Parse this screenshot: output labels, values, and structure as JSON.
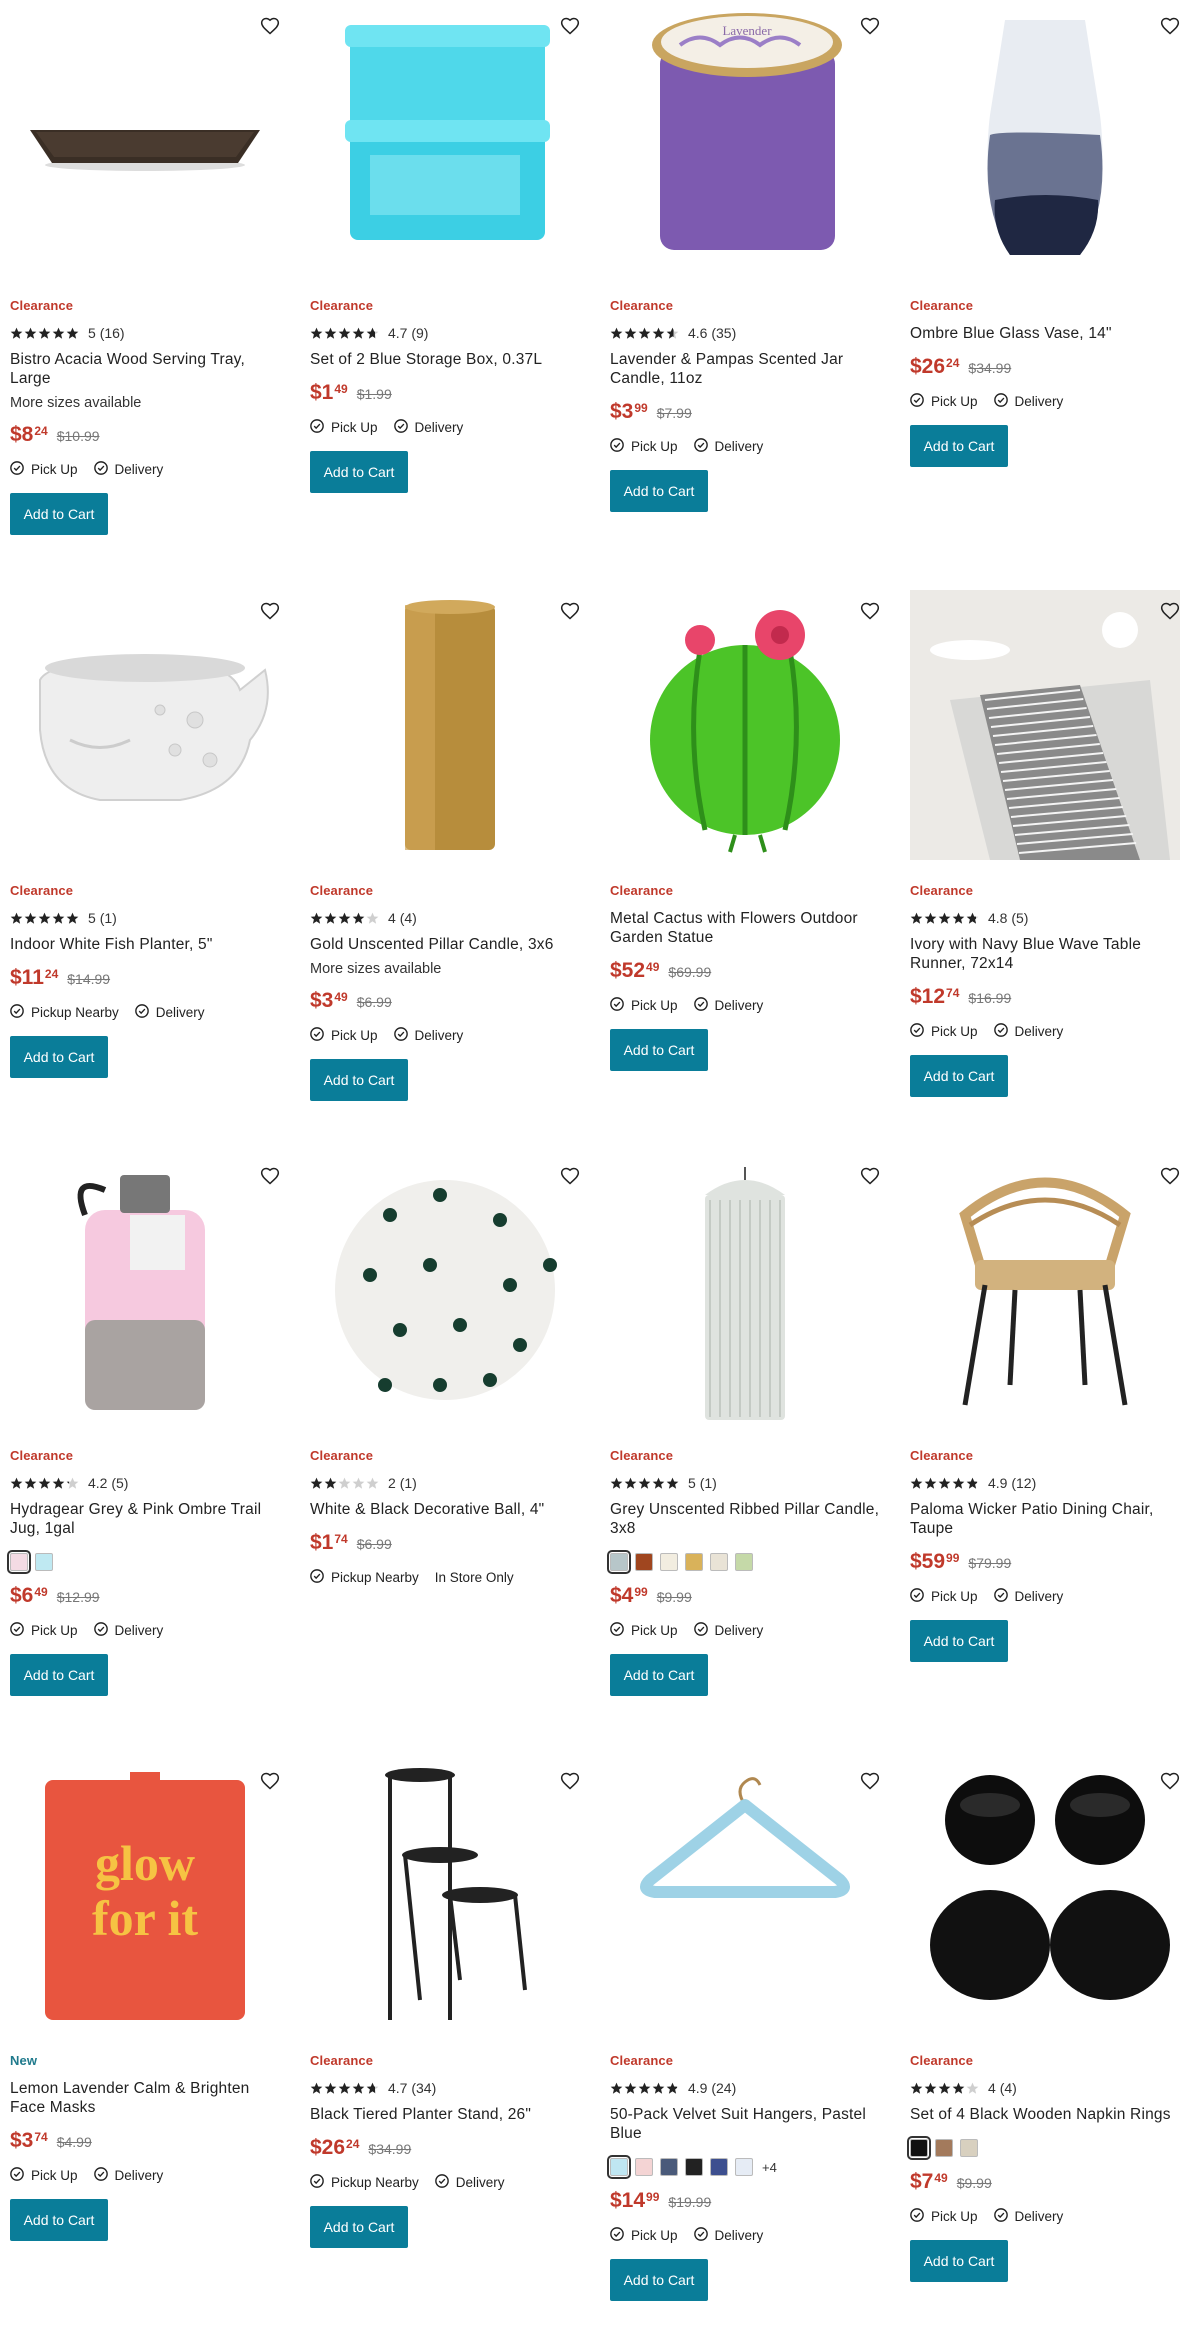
{
  "add_to_cart_label": "Add to Cart",
  "colors": {
    "clearance": "#c0392b",
    "new": "#1f7a8c",
    "button": "#0a7d99",
    "price": "#c0392b"
  },
  "products": [
    {
      "badge": "Clearance",
      "rating": "5",
      "reviews": "(16)",
      "stars": 5,
      "title": "Bistro Acacia Wood Serving Tray, Large",
      "sizes": "More sizes available",
      "price_dollars": "$8",
      "price_cents": "24",
      "was": "$10.99",
      "fulfillment": [
        "Pick Up",
        "Delivery"
      ],
      "image": "serving-tray"
    },
    {
      "badge": "Clearance",
      "rating": "4.7",
      "reviews": "(9)",
      "stars": 4.7,
      "title": "Set of 2 Blue Storage Box, 0.37L",
      "price_dollars": "$1",
      "price_cents": "49",
      "was": "$1.99",
      "fulfillment": [
        "Pick Up",
        "Delivery"
      ],
      "image": "storage-box"
    },
    {
      "badge": "Clearance",
      "rating": "4.6",
      "reviews": "(35)",
      "stars": 4.6,
      "title": "Lavender & Pampas Scented Jar Candle, 11oz",
      "price_dollars": "$3",
      "price_cents": "99",
      "was": "$7.99",
      "fulfillment": [
        "Pick Up",
        "Delivery"
      ],
      "image": "jar-candle"
    },
    {
      "badge": "Clearance",
      "title": "Ombre Blue Glass Vase, 14\"",
      "price_dollars": "$26",
      "price_cents": "24",
      "was": "$34.99",
      "fulfillment": [
        "Pick Up",
        "Delivery"
      ],
      "image": "vase"
    },
    {
      "badge": "Clearance",
      "rating": "5",
      "reviews": "(1)",
      "stars": 5,
      "title": "Indoor White Fish Planter, 5\"",
      "price_dollars": "$11",
      "price_cents": "24",
      "was": "$14.99",
      "fulfillment": [
        "Pickup Nearby",
        "Delivery"
      ],
      "image": "fish-planter"
    },
    {
      "badge": "Clearance",
      "rating": "4",
      "reviews": "(4)",
      "stars": 4,
      "title": "Gold Unscented Pillar Candle, 3x6",
      "sizes": "More sizes available",
      "price_dollars": "$3",
      "price_cents": "49",
      "was": "$6.99",
      "fulfillment": [
        "Pick Up",
        "Delivery"
      ],
      "image": "gold-candle"
    },
    {
      "badge": "Clearance",
      "title": "Metal Cactus with Flowers Outdoor Garden Statue",
      "price_dollars": "$52",
      "price_cents": "49",
      "was": "$69.99",
      "fulfillment": [
        "Pick Up",
        "Delivery"
      ],
      "image": "cactus"
    },
    {
      "badge": "Clearance",
      "rating": "4.8",
      "reviews": "(5)",
      "stars": 4.8,
      "title": "Ivory with Navy Blue Wave Table Runner, 72x14",
      "price_dollars": "$12",
      "price_cents": "74",
      "was": "$16.99",
      "fulfillment": [
        "Pick Up",
        "Delivery"
      ],
      "image": "table-runner"
    },
    {
      "badge": "Clearance",
      "rating": "4.2",
      "reviews": "(5)",
      "stars": 4.2,
      "title": "Hydragear Grey & Pink Ombre Trail Jug, 1gal",
      "swatches": [
        "#f4dbe4",
        "#bfe9f2"
      ],
      "price_dollars": "$6",
      "price_cents": "49",
      "was": "$12.99",
      "fulfillment": [
        "Pick Up",
        "Delivery"
      ],
      "image": "water-jug"
    },
    {
      "badge": "Clearance",
      "rating": "2",
      "reviews": "(1)",
      "stars": 2,
      "title": "White & Black Decorative Ball, 4\"",
      "price_dollars": "$1",
      "price_cents": "74",
      "was": "$6.99",
      "fulfillment": [
        "Pickup Nearby",
        "In Store Only"
      ],
      "fulfillment_check": [
        true,
        false
      ],
      "no_button": true,
      "image": "deco-ball"
    },
    {
      "badge": "Clearance",
      "rating": "5",
      "reviews": "(1)",
      "stars": 5,
      "title": "Grey Unscented Ribbed Pillar Candle, 3x8",
      "swatches": [
        "#b7c6c9",
        "#a0461f",
        "#f2ede0",
        "#d9b25a",
        "#e9e3d6",
        "#c5d9a8"
      ],
      "price_dollars": "$4",
      "price_cents": "99",
      "was": "$9.99",
      "fulfillment": [
        "Pick Up",
        "Delivery"
      ],
      "image": "ribbed-candle"
    },
    {
      "badge": "Clearance",
      "rating": "4.9",
      "reviews": "(12)",
      "stars": 4.9,
      "title": "Paloma Wicker Patio Dining Chair, Taupe",
      "price_dollars": "$59",
      "price_cents": "99",
      "was": "$79.99",
      "fulfillment": [
        "Pick Up",
        "Delivery"
      ],
      "image": "wicker-chair"
    },
    {
      "badge": "New",
      "title": "Lemon Lavender Calm & Brighten Face Masks",
      "price_dollars": "$3",
      "price_cents": "74",
      "was": "$4.99",
      "fulfillment": [
        "Pick Up",
        "Delivery"
      ],
      "image": "face-mask",
      "mask_text": "glow for it"
    },
    {
      "badge": "Clearance",
      "rating": "4.7",
      "reviews": "(34)",
      "stars": 4.7,
      "title": "Black Tiered Planter Stand, 26\"",
      "price_dollars": "$26",
      "price_cents": "24",
      "was": "$34.99",
      "fulfillment": [
        "Pickup Nearby",
        "Delivery"
      ],
      "image": "planter-stand"
    },
    {
      "badge": "Clearance",
      "rating": "4.9",
      "reviews": "(24)",
      "stars": 4.9,
      "title": "50-Pack Velvet Suit Hangers, Pastel Blue",
      "swatches": [
        "#bfe6f2",
        "#f4d4d4",
        "#4a5a7a",
        "#222222",
        "#3d4f8f",
        "#e6ecf5"
      ],
      "swatch_more": "+4",
      "price_dollars": "$14",
      "price_cents": "99",
      "was": "$19.99",
      "fulfillment": [
        "Pick Up",
        "Delivery"
      ],
      "image": "hangers"
    },
    {
      "badge": "Clearance",
      "rating": "4",
      "reviews": "(4)",
      "stars": 4,
      "title": "Set of 4 Black Wooden Napkin Rings",
      "swatches": [
        "#111111",
        "#a37a5c",
        "#d8d0bf"
      ],
      "price_dollars": "$7",
      "price_cents": "49",
      "was": "$9.99",
      "fulfillment": [
        "Pick Up",
        "Delivery"
      ],
      "image": "napkin-rings"
    }
  ]
}
